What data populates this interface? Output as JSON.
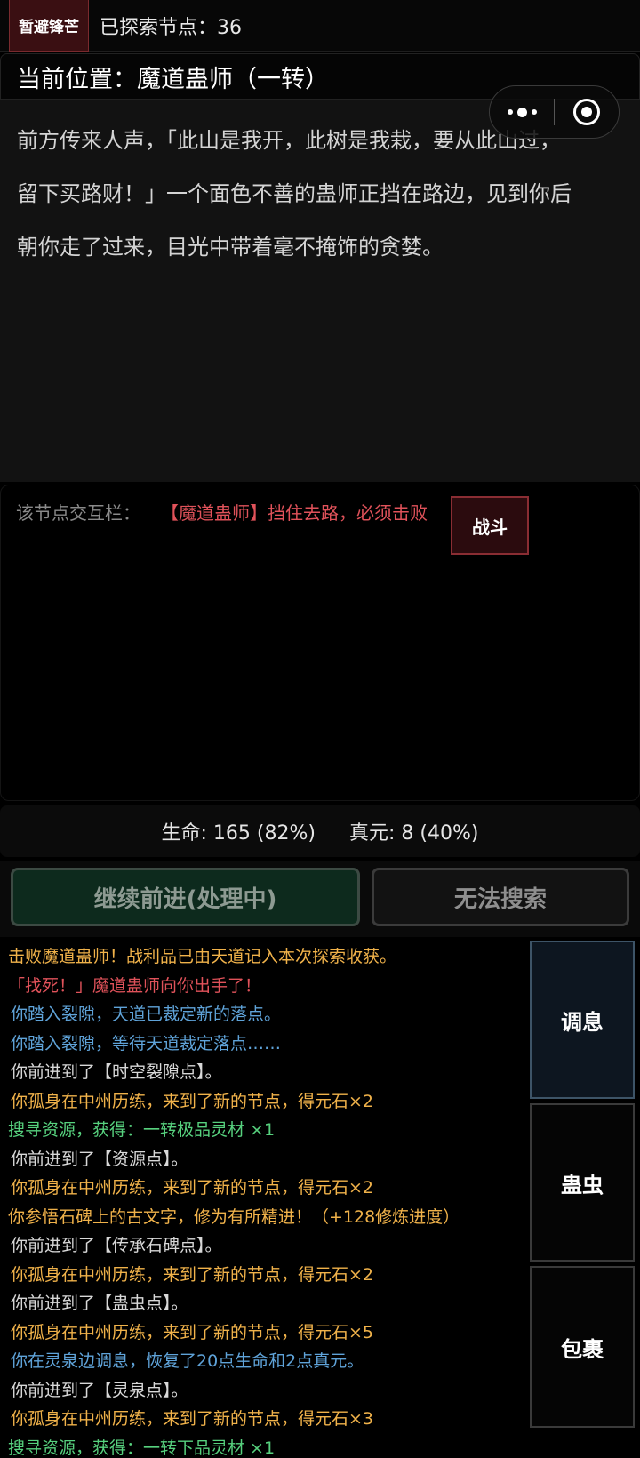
{
  "topbar": {
    "retreat_label": "暂避锋芒",
    "explored_label": "已探索节点：36"
  },
  "location": {
    "title": "当前位置：魔道蛊师（一转）"
  },
  "narrative": {
    "lines": [
      "前方传来人声，「此山是我开，此树是我栽，要从此山过，",
      "留下买路财！」一个面色不善的蛊师正挡在路边，见到你后",
      "朝你走了过来，目光中带着毫不掩饰的贪婪。"
    ]
  },
  "interaction": {
    "label": "该节点交互栏：",
    "message": "【魔道蛊师】挡住去路，必须击败",
    "fight_label": "战斗"
  },
  "stats": {
    "hp": "生命: 165 (82%)",
    "qi": "真元: 8 (40%)"
  },
  "actions": {
    "advance_label": "继续前进(处理中)",
    "search_label": "无法搜索"
  },
  "log": [
    {
      "text": "击败魔道蛊师！战利品已由天道记入本次探索收获。",
      "color": "#f0b24a"
    },
    {
      "text": "「找死！」魔道蛊师向你出手了！",
      "color": "#e0525a"
    },
    {
      "text": "你踏入裂隙，天道已裁定新的落点。",
      "color": "#5fa3d9"
    },
    {
      "text": "你踏入裂隙，等待天道裁定落点……",
      "color": "#5fa3d9"
    },
    {
      "text": "你前进到了【时空裂隙点】。",
      "color": "#d8d8d8"
    },
    {
      "text": "你孤身在中州历练，来到了新的节点，得元石×2",
      "color": "#f0b24a"
    },
    {
      "text": "搜寻资源，获得：一转极品灵材 ×1",
      "color": "#57d17e"
    },
    {
      "text": "你前进到了【资源点】。",
      "color": "#d8d8d8"
    },
    {
      "text": "你孤身在中州历练，来到了新的节点，得元石×2",
      "color": "#f0b24a"
    },
    {
      "text": "你参悟石碑上的古文字，修为有所精进！（+128修炼进度）",
      "color": "#f0b24a"
    },
    {
      "text": "你前进到了【传承石碑点】。",
      "color": "#d8d8d8"
    },
    {
      "text": "你孤身在中州历练，来到了新的节点，得元石×2",
      "color": "#f0b24a"
    },
    {
      "text": "你前进到了【蛊虫点】。",
      "color": "#d8d8d8"
    },
    {
      "text": "你孤身在中州历练，来到了新的节点，得元石×5",
      "color": "#f0b24a"
    },
    {
      "text": "你在灵泉边调息，恢复了20点生命和2点真元。",
      "color": "#5fa3d9"
    },
    {
      "text": "你前进到了【灵泉点】。",
      "color": "#d8d8d8"
    },
    {
      "text": "你孤身在中州历练，来到了新的节点，得元石×3",
      "color": "#f0b24a"
    },
    {
      "text": "搜寻资源，获得：一转下品灵材 ×1",
      "color": "#57d17e"
    }
  ],
  "side": {
    "rest_label": "调息",
    "gu_label": "蛊虫",
    "bag_label": "包裹"
  },
  "colors": {
    "accent_red": "#e0525a",
    "gold": "#f0b24a",
    "blue": "#5fa3d9",
    "green": "#57d17e"
  },
  "icons": {
    "capsule_more": "more-dots-icon",
    "capsule_close": "target-circle-icon"
  }
}
